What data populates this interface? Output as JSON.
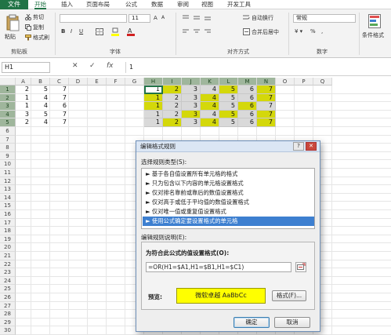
{
  "ribbon": {
    "tabs": [
      "文件",
      "开始",
      "插入",
      "页面布局",
      "公式",
      "数据",
      "审阅",
      "视图",
      "开发工具"
    ],
    "active_tab": "开始",
    "clipboard": {
      "paste": "粘贴",
      "cut": "剪切",
      "copy": "复制",
      "format_painter": "格式刷",
      "group": "剪贴板"
    },
    "font": {
      "size": "11",
      "group": "字体"
    },
    "alignment": {
      "wrap_text": "自动换行",
      "merge_center": "合并后居中",
      "group": "对齐方式"
    },
    "number": {
      "format": "常规",
      "group": "数字"
    },
    "styles": {
      "conditional_format": "条件格式"
    }
  },
  "formula_bar": {
    "name_box": "H1",
    "cancel": "✕",
    "confirm": "✓",
    "fx": "fx",
    "value": "1"
  },
  "sheet": {
    "columns": [
      "A",
      "B",
      "C",
      "D",
      "E",
      "F",
      "G",
      "H",
      "I",
      "J",
      "K",
      "L",
      "M",
      "N",
      "O",
      "P",
      "Q"
    ],
    "rows": [
      "1",
      "2",
      "3",
      "4",
      "5",
      "6",
      "7",
      "8",
      "9",
      "10",
      "11",
      "12",
      "13",
      "14",
      "15",
      "16",
      "17",
      "18",
      "19",
      "20",
      "21",
      "22",
      "23",
      "24",
      "25",
      "26",
      "27",
      "28",
      "29",
      "30"
    ],
    "abc": [
      [
        "2",
        "5",
        "7"
      ],
      [
        "1",
        "4",
        "7"
      ],
      [
        "1",
        "4",
        "6"
      ],
      [
        "3",
        "5",
        "7"
      ],
      [
        "2",
        "4",
        "7"
      ]
    ],
    "highlight_values": [
      "1",
      "2",
      "3",
      "4",
      "5",
      "6",
      "7"
    ],
    "colors": {
      "highlight": "#d4d80a",
      "gray": "#d9d9d9"
    }
  },
  "dialog": {
    "title": "编辑格式规则",
    "help": "?",
    "close": "✕",
    "select_type_label": "选择规则类型(S):",
    "rule_types": [
      "► 基于各自值设置所有单元格的格式",
      "► 只为包含以下内容的单元格设置格式",
      "► 仅对排名靠前或靠后的数值设置格式",
      "► 仅对高于或低于平均值的数值设置格式",
      "► 仅对唯一值或重复值设置格式",
      "► 使用公式确定要设置格式的单元格"
    ],
    "selected_rule_index": 5,
    "edit_desc_label": "编辑规则说明(E):",
    "formula_label": "为符合此公式的值设置格式(O):",
    "formula": "=OR(H1=$A1,H1=$B1,H1=$C1)",
    "preview_label": "预览:",
    "preview_text": "微软卓越  AaBbCc",
    "format_button": "格式(F)...",
    "ok": "确定",
    "cancel": "取消",
    "preview_color": "#ffff00"
  }
}
